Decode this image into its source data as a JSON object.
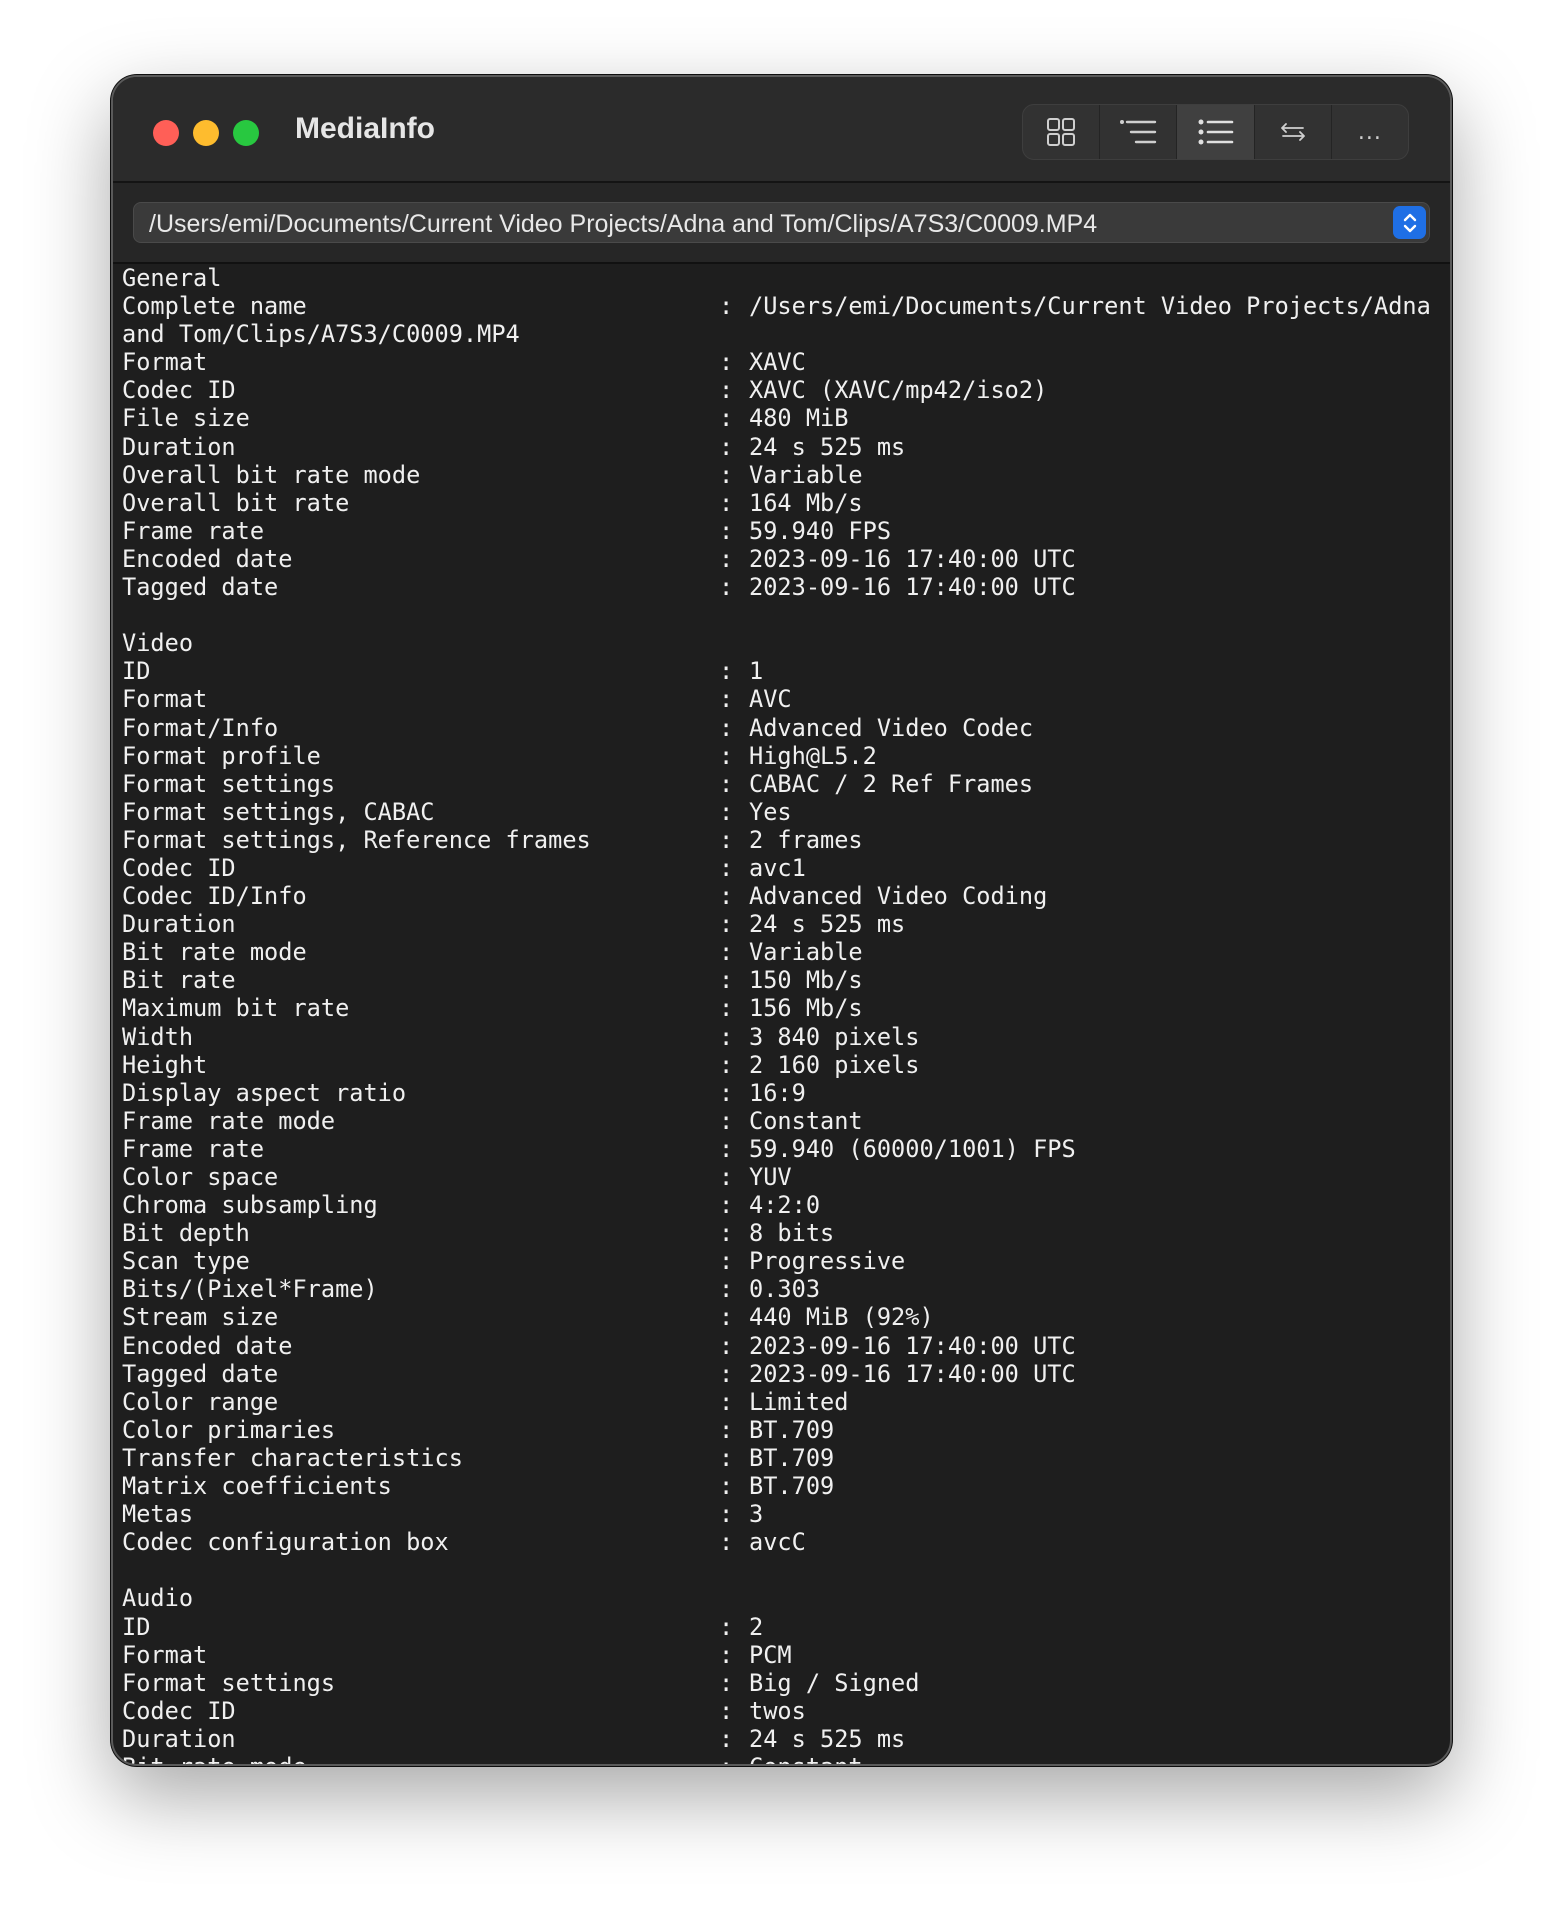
{
  "window": {
    "title": "MediaInfo",
    "toolbar": {
      "buttons": [
        {
          "icon": "grid-view-icon"
        },
        {
          "icon": "tree-view-icon"
        },
        {
          "icon": "list-view-icon"
        },
        {
          "icon": "swap-arrows-icon"
        },
        {
          "icon": "more-icon",
          "glyph": "..."
        }
      ],
      "active_index": 2
    }
  },
  "path_selector": {
    "value": "/Users/emi/Documents/Current Video Projects/Adna and Tom/Clips/A7S3/C0009.MP4"
  },
  "report": {
    "separator": ":",
    "general": {
      "heading": "General",
      "complete_name": {
        "key": "Complete name",
        "value": "/Users/emi/Documents/Current Video Projects/Adna",
        "continuation": "and Tom/Clips/A7S3/C0009.MP4"
      },
      "rows": [
        {
          "key": "Format",
          "value": "XAVC"
        },
        {
          "key": "Codec ID",
          "value": "XAVC (XAVC/mp42/iso2)"
        },
        {
          "key": "File size",
          "value": "480 MiB"
        },
        {
          "key": "Duration",
          "value": "24 s 525 ms"
        },
        {
          "key": "Overall bit rate mode",
          "value": "Variable"
        },
        {
          "key": "Overall bit rate",
          "value": "164 Mb/s"
        },
        {
          "key": "Frame rate",
          "value": "59.940 FPS"
        },
        {
          "key": "Encoded date",
          "value": "2023-09-16 17:40:00 UTC"
        },
        {
          "key": "Tagged date",
          "value": "2023-09-16 17:40:00 UTC"
        }
      ]
    },
    "video": {
      "heading": "Video",
      "rows": [
        {
          "key": "ID",
          "value": "1"
        },
        {
          "key": "Format",
          "value": "AVC"
        },
        {
          "key": "Format/Info",
          "value": "Advanced Video Codec"
        },
        {
          "key": "Format profile",
          "value": "High@L5.2"
        },
        {
          "key": "Format settings",
          "value": "CABAC / 2 Ref Frames"
        },
        {
          "key": "Format settings, CABAC",
          "value": "Yes"
        },
        {
          "key": "Format settings, Reference frames",
          "value": "2 frames"
        },
        {
          "key": "Codec ID",
          "value": "avc1"
        },
        {
          "key": "Codec ID/Info",
          "value": "Advanced Video Coding"
        },
        {
          "key": "Duration",
          "value": "24 s 525 ms"
        },
        {
          "key": "Bit rate mode",
          "value": "Variable"
        },
        {
          "key": "Bit rate",
          "value": "150 Mb/s"
        },
        {
          "key": "Maximum bit rate",
          "value": "156 Mb/s"
        },
        {
          "key": "Width",
          "value": "3 840 pixels"
        },
        {
          "key": "Height",
          "value": "2 160 pixels"
        },
        {
          "key": "Display aspect ratio",
          "value": "16:9"
        },
        {
          "key": "Frame rate mode",
          "value": "Constant"
        },
        {
          "key": "Frame rate",
          "value": "59.940 (60000/1001) FPS"
        },
        {
          "key": "Color space",
          "value": "YUV"
        },
        {
          "key": "Chroma subsampling",
          "value": "4:2:0"
        },
        {
          "key": "Bit depth",
          "value": "8 bits"
        },
        {
          "key": "Scan type",
          "value": "Progressive"
        },
        {
          "key": "Bits/(Pixel*Frame)",
          "value": "0.303"
        },
        {
          "key": "Stream size",
          "value": "440 MiB (92%)"
        },
        {
          "key": "Encoded date",
          "value": "2023-09-16 17:40:00 UTC"
        },
        {
          "key": "Tagged date",
          "value": "2023-09-16 17:40:00 UTC"
        },
        {
          "key": "Color range",
          "value": "Limited"
        },
        {
          "key": "Color primaries",
          "value": "BT.709"
        },
        {
          "key": "Transfer characteristics",
          "value": "BT.709"
        },
        {
          "key": "Matrix coefficients",
          "value": "BT.709"
        },
        {
          "key": "Metas",
          "value": "3"
        },
        {
          "key": "Codec configuration box",
          "value": "avcC"
        }
      ]
    },
    "audio": {
      "heading": "Audio",
      "rows": [
        {
          "key": "ID",
          "value": "2"
        },
        {
          "key": "Format",
          "value": "PCM"
        },
        {
          "key": "Format settings",
          "value": "Big / Signed"
        },
        {
          "key": "Codec ID",
          "value": "twos"
        },
        {
          "key": "Duration",
          "value": "24 s 525 ms"
        },
        {
          "key": "Bit rate mode",
          "value": "Constant"
        }
      ]
    }
  },
  "colors": {
    "window_bg": "#1e1e1e",
    "titlebar_bg": "#2b2b2b",
    "accent": "#1f6fe5",
    "close": "#ff5f57",
    "minimize": "#febc2e",
    "maximize": "#28c840"
  }
}
